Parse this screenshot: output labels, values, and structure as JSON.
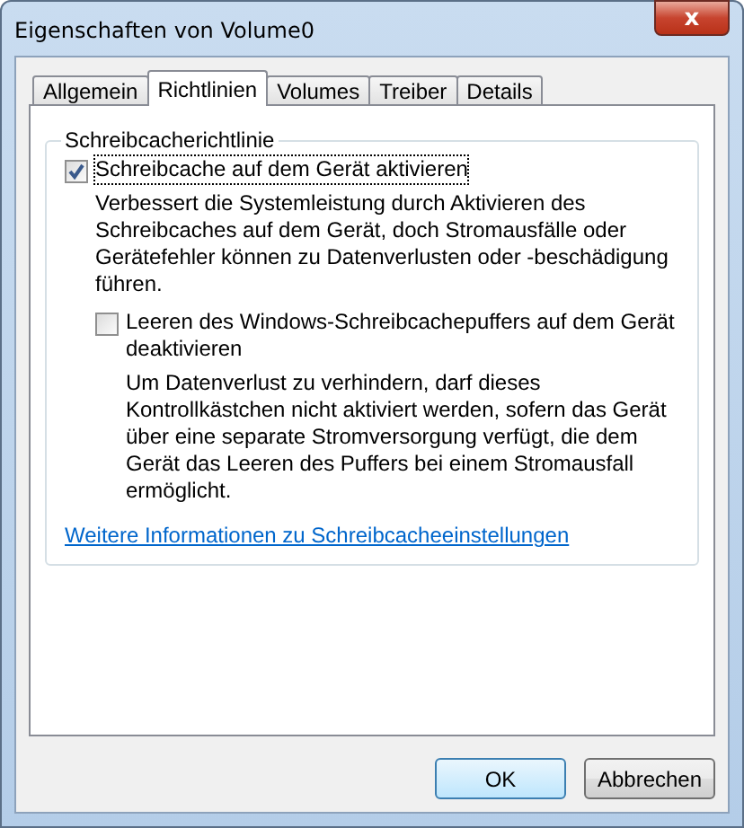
{
  "window": {
    "title": "Eigenschaften von Volume0",
    "close": "x"
  },
  "tabs": [
    {
      "label": "Allgemein",
      "selected": false
    },
    {
      "label": "Richtlinien",
      "selected": true
    },
    {
      "label": "Volumes",
      "selected": false
    },
    {
      "label": "Treiber",
      "selected": false
    },
    {
      "label": "Details",
      "selected": false
    }
  ],
  "group": {
    "title": "Schreibcacherichtlinie",
    "options": [
      {
        "label": "Schreibcache auf dem Gerät aktivieren",
        "checked": true,
        "focused": true,
        "description": "Verbessert die Systemleistung durch Aktivieren des Schreibcaches auf dem Gerät, doch Stromausfälle oder Gerätefehler können zu Datenverlusten oder -beschädigung führen.",
        "options": [
          {
            "label": "Leeren des Windows-Schreibcachepuffers auf dem Gerät deaktivieren",
            "checked": false,
            "focused": false,
            "description": "Um Datenverlust zu verhindern, darf dieses Kontrollkästchen nicht aktiviert werden, sofern das Gerät über eine separate Stromversorgung verfügt, die dem Gerät das Leeren des Puffers bei einem Stromausfall ermöglicht."
          }
        ]
      }
    ],
    "link": "Weitere Informationen zu Schreibcacheeinstellungen"
  },
  "buttons": [
    {
      "label": "OK",
      "default": true
    },
    {
      "label": "Abbrechen",
      "default": false
    }
  ]
}
